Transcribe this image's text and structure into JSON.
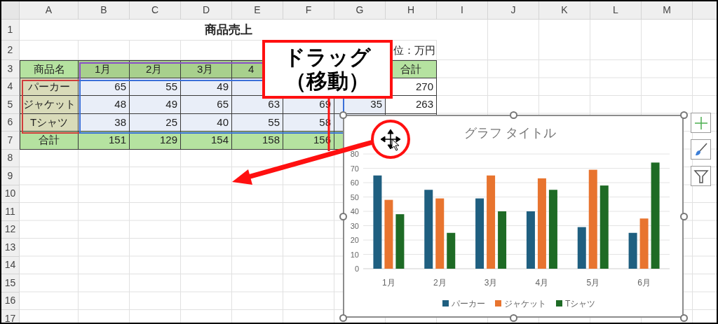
{
  "column_headers": [
    "A",
    "B",
    "C",
    "D",
    "E",
    "F",
    "G",
    "H",
    "I",
    "J",
    "K",
    "L",
    "M"
  ],
  "row_headers": [
    "1",
    "2",
    "3",
    "4",
    "5",
    "6",
    "7",
    "8",
    "9",
    "10",
    "11",
    "12",
    "13",
    "14",
    "15",
    "16",
    "17"
  ],
  "sheet": {
    "title": "商品売上",
    "unit": "位：万円",
    "header": {
      "name": "商品名",
      "months": [
        "1月",
        "2月",
        "3月",
        "4"
      ],
      "total": "合計"
    },
    "rows": [
      {
        "name": "パーカー",
        "values": [
          "65",
          "55",
          "49"
        ],
        "total": "270"
      },
      {
        "name": "ジャケット",
        "values": [
          "48",
          "49",
          "65",
          "63",
          "69",
          "35"
        ],
        "total": "263"
      },
      {
        "name": "Tシャツ",
        "values": [
          "38",
          "25",
          "40",
          "55",
          "58"
        ]
      }
    ],
    "total_row": {
      "name": "合計",
      "values": [
        "151",
        "129",
        "154",
        "158",
        "156"
      ]
    }
  },
  "callout": {
    "lines": [
      "ドラッグ",
      "（移動）"
    ]
  },
  "chart": {
    "chart_data": {
      "type": "bar",
      "title": "グラフ タイトル",
      "categories": [
        "1月",
        "2月",
        "3月",
        "4月",
        "5月",
        "6月"
      ],
      "series": [
        {
          "name": "パーカー",
          "color": "#1f5f80",
          "values": [
            65,
            55,
            49,
            40,
            29,
            25
          ]
        },
        {
          "name": "ジャケット",
          "color": "#e8742f",
          "values": [
            48,
            49,
            65,
            63,
            69,
            35
          ]
        },
        {
          "name": "Tシャツ",
          "color": "#1e6b25",
          "values": [
            38,
            25,
            40,
            55,
            58,
            74
          ]
        }
      ],
      "ylim": [
        0,
        80
      ],
      "yticks": [
        0,
        10,
        20,
        30,
        40,
        50,
        60,
        70,
        80
      ],
      "grid": true,
      "legend": true
    }
  }
}
